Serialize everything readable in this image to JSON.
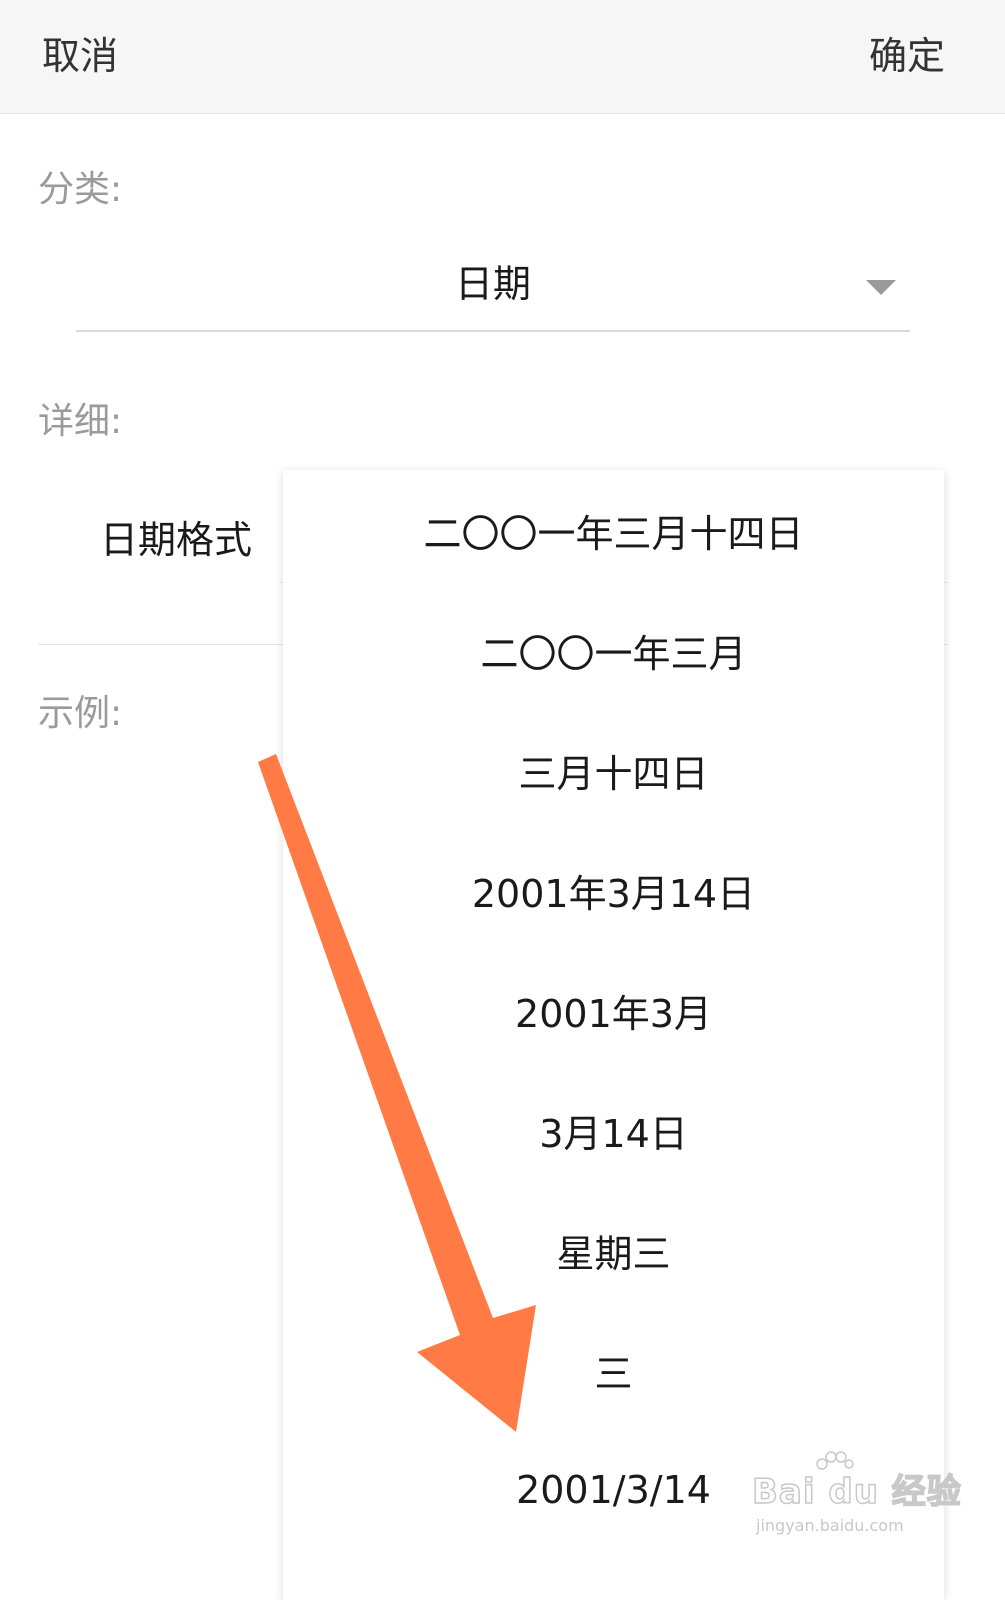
{
  "header": {
    "cancel_label": "取消",
    "confirm_label": "确定"
  },
  "category": {
    "label": "分类:",
    "value": "日期"
  },
  "detail": {
    "label": "详细:",
    "format_label": "日期格式"
  },
  "example": {
    "label": "示例:"
  },
  "dropdown": {
    "options": [
      "二〇〇一年三月十四日",
      "二〇〇一年三月",
      "三月十四日",
      "2001年3月14日",
      "2001年3月",
      "3月14日",
      "星期三",
      "三",
      "2001/3/14"
    ]
  },
  "annotation": {
    "arrow_color": "#ff7a45"
  },
  "watermark": {
    "logo_text": "Bai du 经验",
    "url_text": "jingyan.baidu.com"
  }
}
